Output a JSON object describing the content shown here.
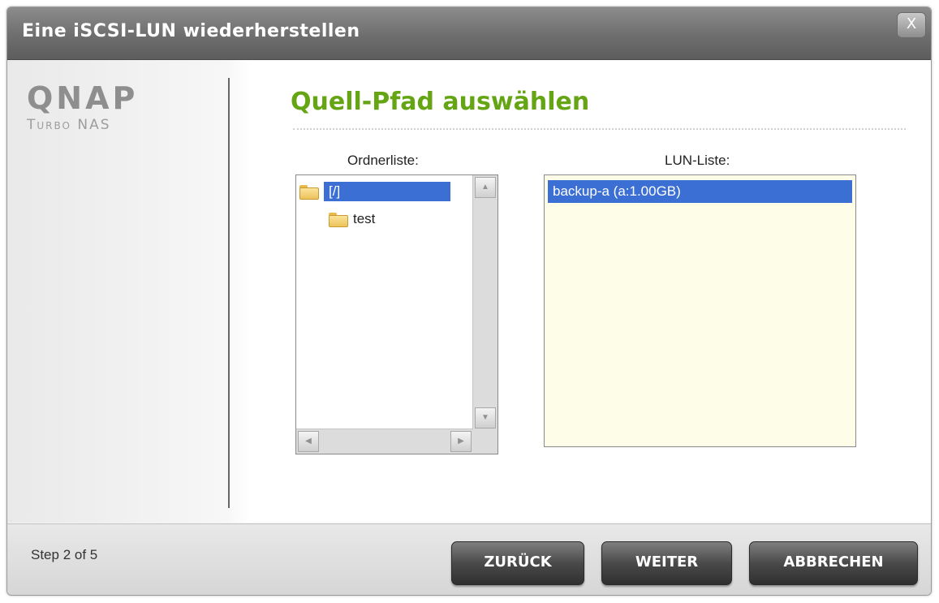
{
  "dialog": {
    "title": "Eine iSCSI-LUN wiederherstellen",
    "close_label": "X"
  },
  "logo": {
    "name": "QNAP",
    "subtitle": "Turbo NAS"
  },
  "main": {
    "heading": "Quell-Pfad auswählen",
    "folder_list": {
      "label": "Ordnerliste:",
      "items": [
        "[/]",
        "test"
      ],
      "selected": "[/]"
    },
    "lun_list": {
      "label": "LUN-Liste:",
      "items": [
        "backup-a (a:1.00GB)"
      ],
      "selected": "backup-a (a:1.00GB)"
    }
  },
  "footer": {
    "step": "Step 2 of 5",
    "buttons": {
      "back": "ZURÜCK",
      "next": "WEITER",
      "cancel": "ABBRECHEN"
    }
  },
  "colors": {
    "heading": "#65a514",
    "selection": "#3c6fd4",
    "titlebar": "#6e6e6e",
    "lun_background": "#fdfde8"
  },
  "icons": {
    "folder": "folder-icon",
    "open_folder": "folder-open-icon"
  }
}
